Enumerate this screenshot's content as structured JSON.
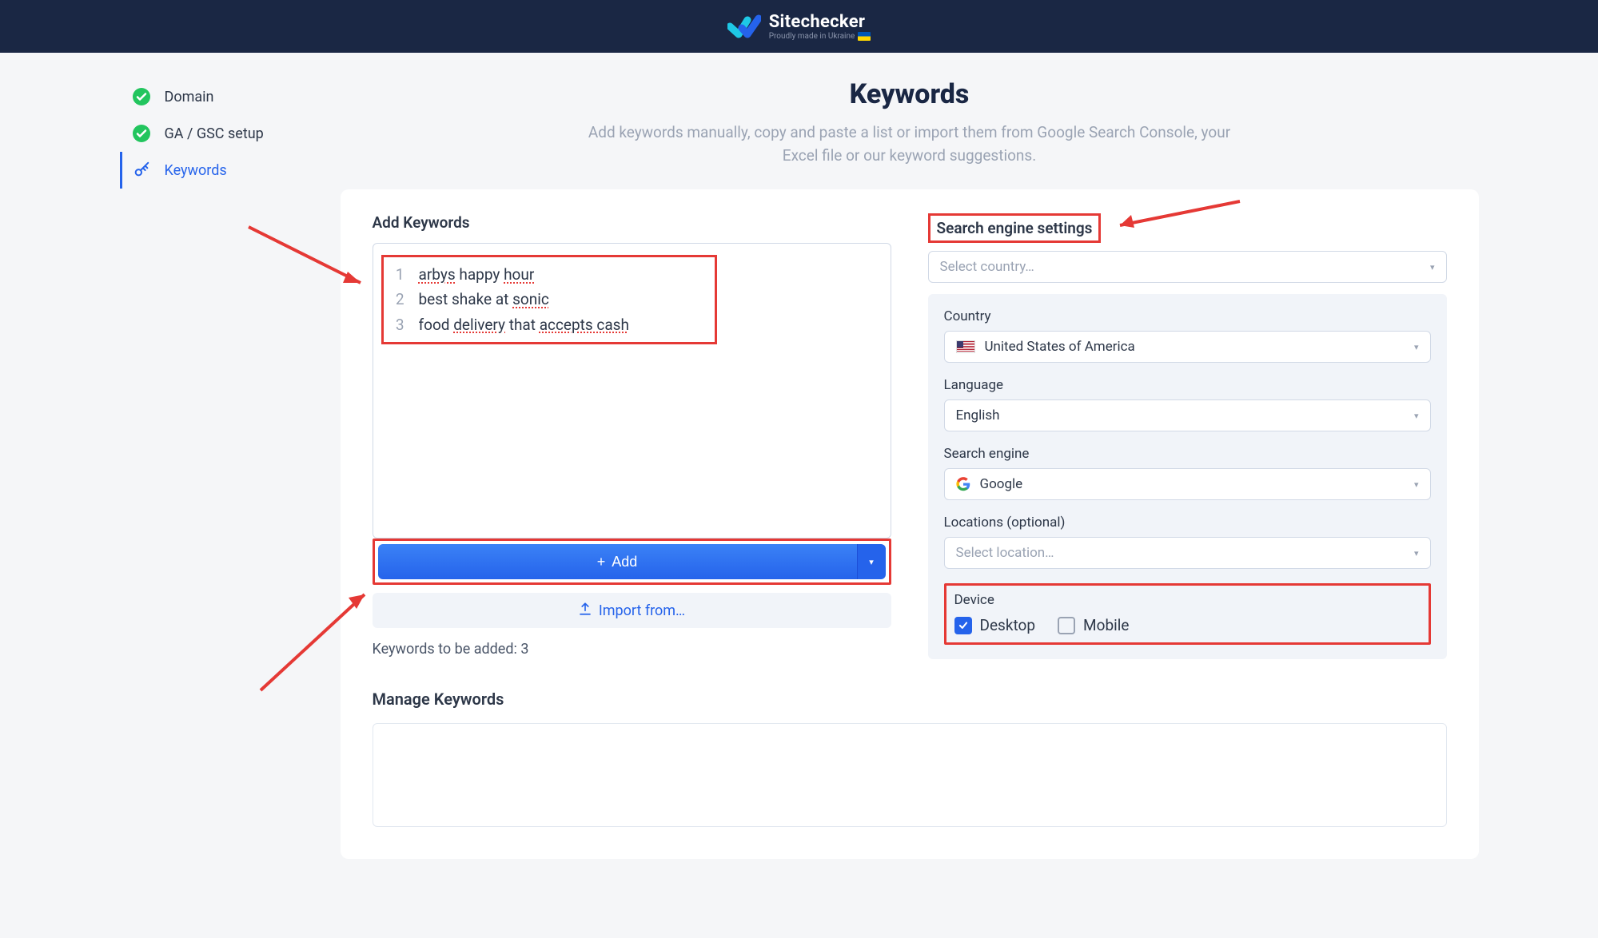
{
  "header": {
    "brand": "Sitechecker",
    "tagline": "Proudly made in Ukraine"
  },
  "sidebar": {
    "items": [
      {
        "label": "Domain"
      },
      {
        "label": "GA / GSC setup"
      },
      {
        "label": "Keywords"
      }
    ]
  },
  "page": {
    "title": "Keywords",
    "desc": "Add keywords manually, copy and paste a list or import them from Google Search Console, your Excel file or our keyword suggestions."
  },
  "addKeywords": {
    "label": "Add Keywords",
    "lines": [
      "arbys happy hour",
      "best shake at sonic",
      "food delivery that accepts cash"
    ],
    "addButton": "Add",
    "importButton": "Import from…",
    "countText": "Keywords to be added: 3"
  },
  "settings": {
    "label": "Search engine settings",
    "countryPlaceholder": "Select country…",
    "countryFieldLabel": "Country",
    "countryValue": "United States of America",
    "languageLabel": "Language",
    "languageValue": "English",
    "engineLabel": "Search engine",
    "engineValue": "Google",
    "locationsLabel": "Locations (optional)",
    "locationsPlaceholder": "Select location…",
    "deviceLabel": "Device",
    "desktopLabel": "Desktop",
    "mobileLabel": "Mobile"
  },
  "manage": {
    "label": "Manage Keywords"
  }
}
